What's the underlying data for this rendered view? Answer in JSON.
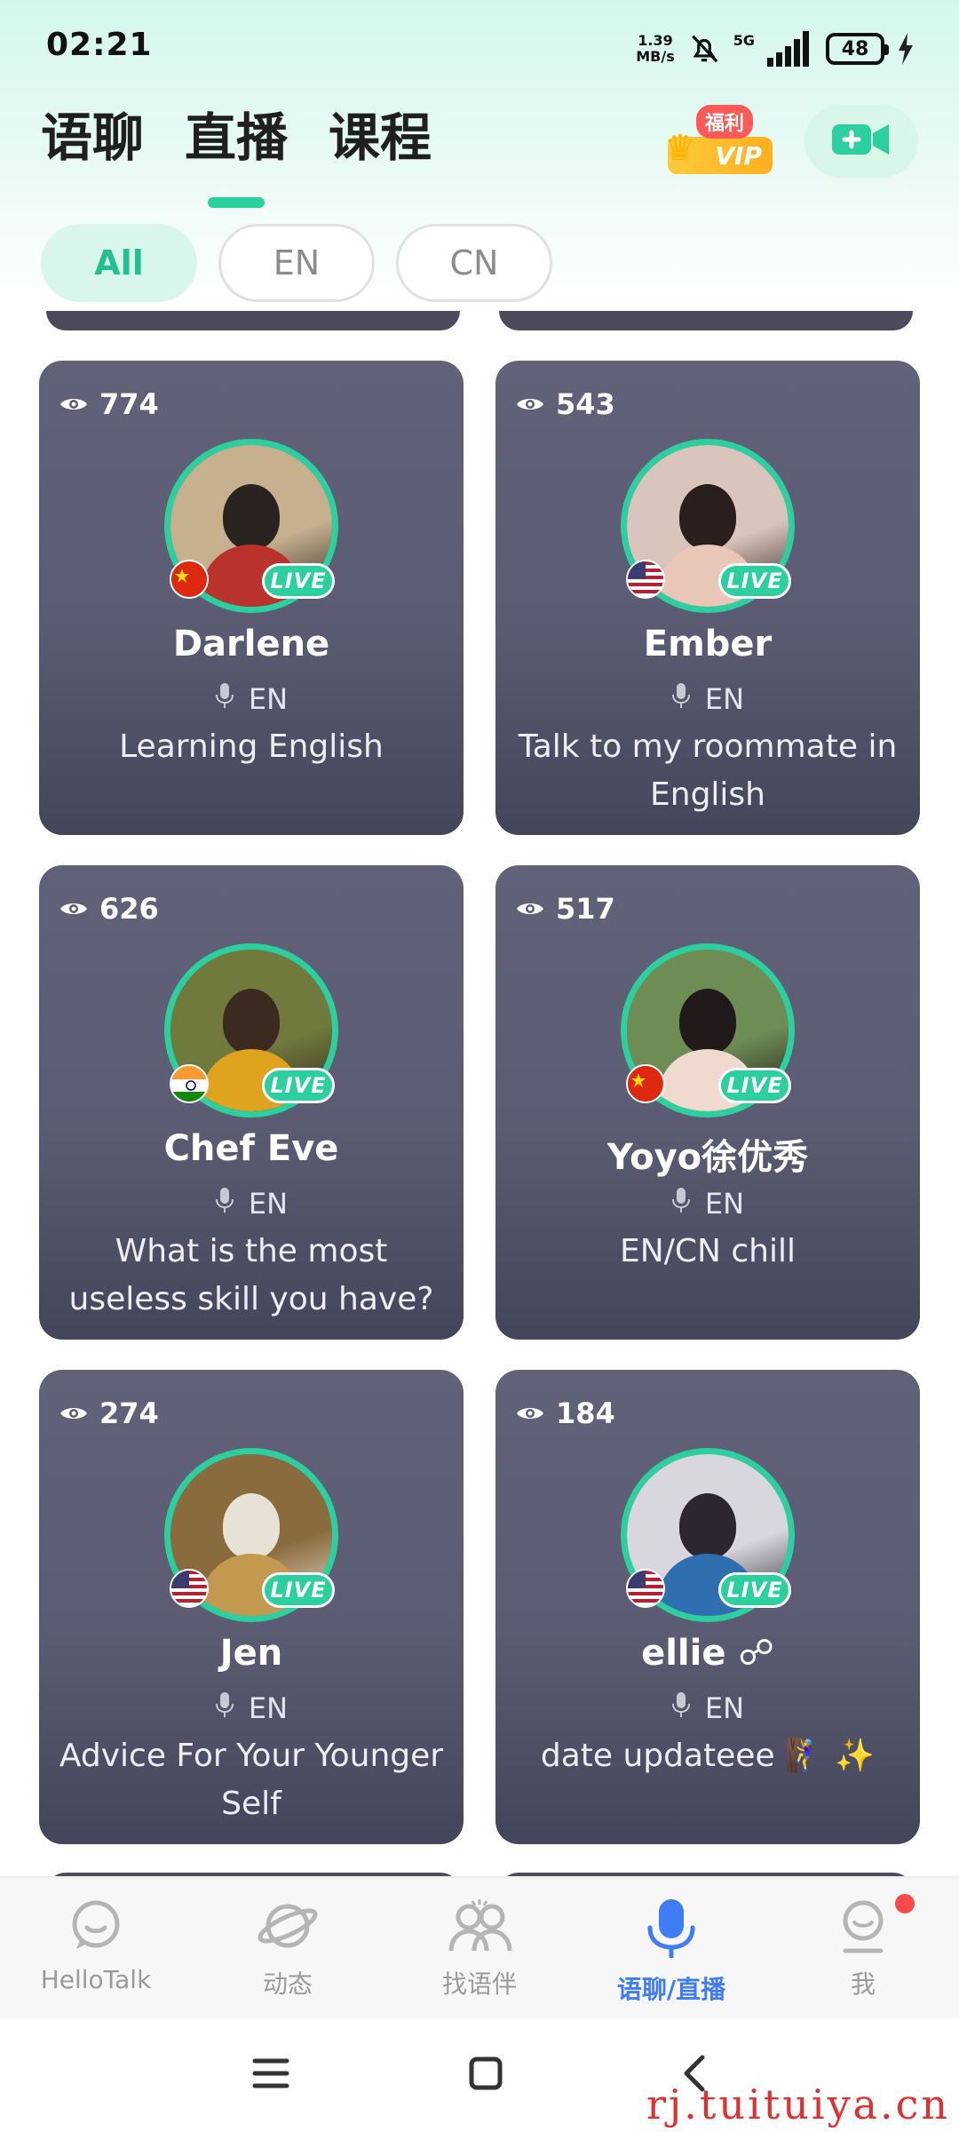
{
  "status_bar": {
    "time": "02:21",
    "net_speed_value": "1.39",
    "net_speed_unit": "MB/s",
    "net_type": "5G",
    "battery": "48"
  },
  "header": {
    "tabs": [
      {
        "label": "语聊",
        "active": false
      },
      {
        "label": "直播",
        "active": true
      },
      {
        "label": "课程",
        "active": false
      }
    ],
    "vip_tag": "福利",
    "vip_label": "VIP"
  },
  "filters": [
    {
      "label": "All",
      "active": true
    },
    {
      "label": "EN",
      "active": false
    },
    {
      "label": "CN",
      "active": false
    }
  ],
  "rooms": [
    {
      "views": "774",
      "name": "Darlene",
      "lang": "EN",
      "title": "Learning English",
      "flag": "china",
      "live": "LIVE",
      "avatar_palette": [
        "#c7b08e",
        "#2a2320",
        "#b9322c"
      ]
    },
    {
      "views": "543",
      "name": "Ember",
      "lang": "EN",
      "title": "Talk to my roommate in English",
      "flag": "usa",
      "live": "LIVE",
      "avatar_palette": [
        "#d9c5bb",
        "#2a1f1c",
        "#e8c7b8"
      ]
    },
    {
      "views": "626",
      "name": "Chef Eve",
      "lang": "EN",
      "title": "What is the most useless skill you have?",
      "flag": "india",
      "live": "LIVE",
      "avatar_palette": [
        "#6f7a3c",
        "#3a2a1f",
        "#e0a31e"
      ]
    },
    {
      "views": "517",
      "name": "Yoyo徐优秀",
      "lang": "EN",
      "title": "EN/CN chill",
      "flag": "china",
      "live": "LIVE",
      "avatar_palette": [
        "#6e8d55",
        "#201a1a",
        "#f0d9cf"
      ]
    },
    {
      "views": "274",
      "name": "Jen",
      "lang": "EN",
      "title": "Advice For Your Younger Self",
      "flag": "usa",
      "live": "LIVE",
      "avatar_palette": [
        "#8a6b3d",
        "#e8e2d6",
        "#c2994f"
      ]
    },
    {
      "views": "184",
      "name": "ellie ☍",
      "lang": "EN",
      "title": "date updateee 🧗‍♀️ ✨",
      "flag": "usa",
      "live": "LIVE",
      "avatar_palette": [
        "#d7d7dd",
        "#2b2630",
        "#2f6fb0"
      ]
    }
  ],
  "bottom_nav": [
    {
      "label": "HelloTalk",
      "icon": "chat-bubble-icon",
      "active": false
    },
    {
      "label": "动态",
      "icon": "planet-icon",
      "active": false
    },
    {
      "label": "找语伴",
      "icon": "people-icon",
      "active": false
    },
    {
      "label": "语聊/直播",
      "icon": "microphone-icon",
      "active": true
    },
    {
      "label": "我",
      "icon": "profile-icon",
      "active": false
    }
  ],
  "watermark": "rj.tuituiya.cn",
  "colors": {
    "accent": "#2ccf9e",
    "card": "#5b5c73",
    "nav_active": "#3f7cf5"
  }
}
